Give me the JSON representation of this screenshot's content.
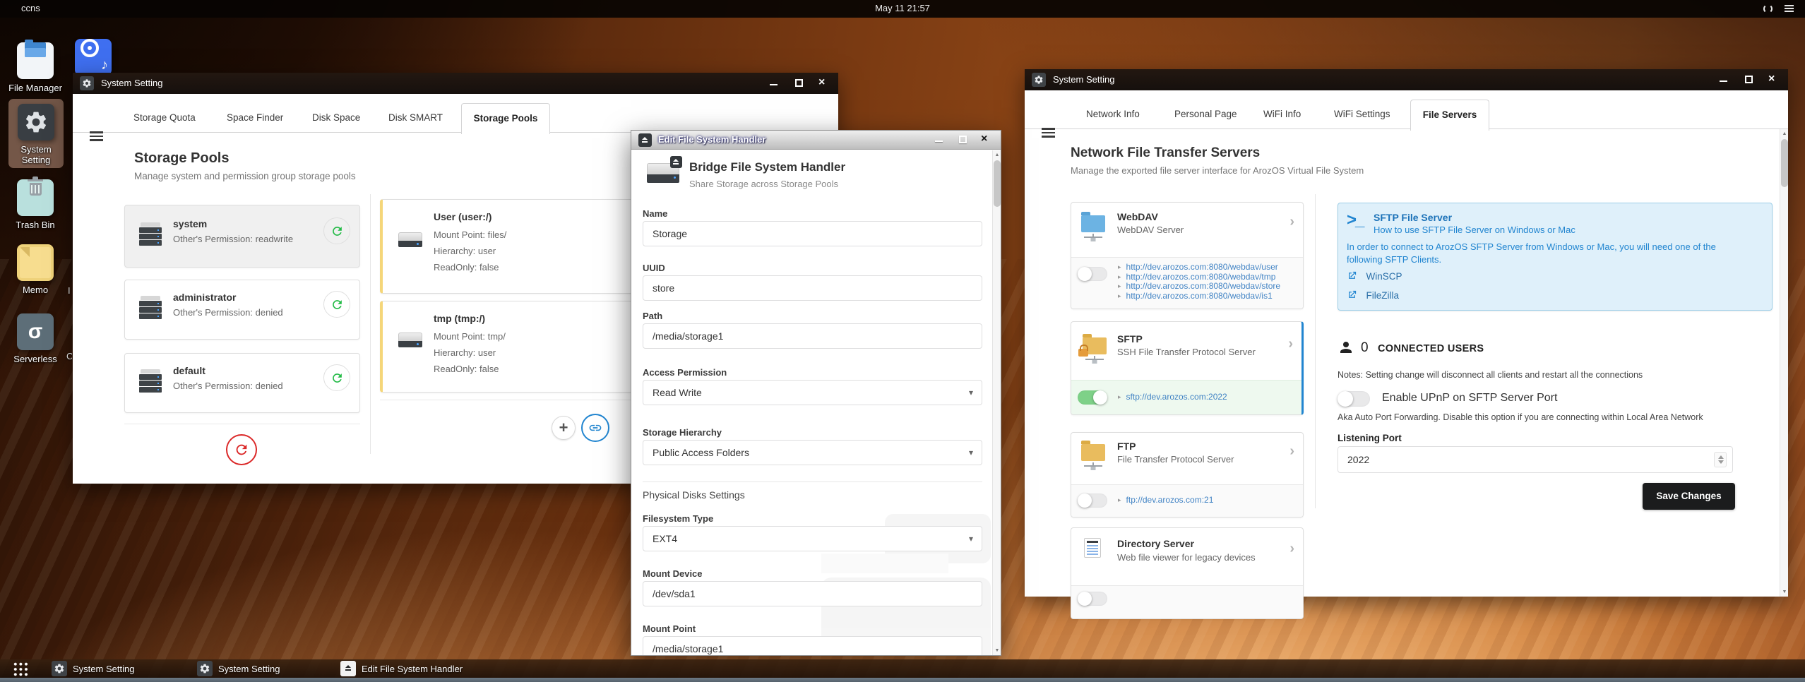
{
  "menubar": {
    "host": "ccns",
    "clock": "May 11 21:57"
  },
  "desktop": {
    "icons": [
      {
        "label": "File Manager"
      },
      {
        "label": ""
      },
      {
        "label": "System Setting"
      },
      {
        "label": "Trash Bin"
      },
      {
        "label": "Memo"
      },
      {
        "label": "Serverless"
      }
    ],
    "clipped_labels": [
      "I",
      "C"
    ]
  },
  "left_window": {
    "title": "System Setting",
    "tabs": [
      "Storage Quota",
      "Space Finder",
      "Disk Space",
      "Disk SMART",
      "Storage Pools"
    ],
    "heading": "Storage Pools",
    "subheading": "Manage system and permission group storage pools",
    "pools": [
      {
        "name": "system",
        "detail": "Other's Permission: readwrite"
      },
      {
        "name": "administrator",
        "detail": "Other's Permission: denied"
      },
      {
        "name": "default",
        "detail": "Other's Permission: denied"
      }
    ],
    "mounts": [
      {
        "name": "User (user:/)",
        "lines": [
          "Mount Point: files/",
          "Hierarchy: user",
          "ReadOnly: false"
        ]
      },
      {
        "name": "tmp (tmp:/)",
        "lines": [
          "Mount Point: tmp/",
          "Hierarchy: user",
          "ReadOnly: false"
        ]
      }
    ]
  },
  "dialog": {
    "title": "Edit File System Handler",
    "heading": "Bridge File System Handler",
    "subheading": "Share Storage across Storage Pools",
    "section_label": "Physical Disks Settings",
    "fields": {
      "name": {
        "label": "Name",
        "value": "Storage"
      },
      "uuid": {
        "label": "UUID",
        "value": "store"
      },
      "path": {
        "label": "Path",
        "value": "/media/storage1"
      },
      "access_permission": {
        "label": "Access Permission",
        "value": "Read Write"
      },
      "storage_hierarchy": {
        "label": "Storage Hierarchy",
        "value": "Public Access Folders"
      },
      "filesystem_type": {
        "label": "Filesystem Type",
        "value": "EXT4"
      },
      "mount_device": {
        "label": "Mount Device",
        "value": "/dev/sda1"
      },
      "mount_point": {
        "label": "Mount Point",
        "value": "/media/storage1"
      }
    }
  },
  "right_window": {
    "title": "System Setting",
    "tabs": [
      "Network Info",
      "Personal Page",
      "WiFi Info",
      "WiFi Settings",
      "File Servers"
    ],
    "heading": "Network File Transfer Servers",
    "subheading": "Manage the exported file server interface for ArozOS Virtual File System",
    "servers": [
      {
        "name": "WebDAV",
        "desc": "WebDAV Server",
        "enabled": false,
        "links": [
          "http://dev.arozos.com:8080/webdav/user",
          "http://dev.arozos.com:8080/webdav/tmp",
          "http://dev.arozos.com:8080/webdav/store",
          "http://dev.arozos.com:8080/webdav/is1"
        ]
      },
      {
        "name": "SFTP",
        "desc": "SSH File Transfer Protocol Server",
        "enabled": true,
        "links": [
          "sftp://dev.arozos.com:2022"
        ]
      },
      {
        "name": "FTP",
        "desc": "File Transfer Protocol Server",
        "enabled": false,
        "links": [
          "ftp://dev.arozos.com:21"
        ]
      },
      {
        "name": "Directory Server",
        "desc": "Web file viewer for legacy devices"
      }
    ],
    "sftp_help": {
      "title": "SFTP File Server",
      "subtitle": "How to use SFTP File Server on Windows or Mac",
      "body": "In order to connect to ArozOS SFTP Server from Windows or Mac, you will need one of the following SFTP Clients.",
      "clients": [
        "WinSCP",
        "FileZilla"
      ]
    },
    "sftp_settings": {
      "connected_count": "0",
      "connected_label": "CONNECTED USERS",
      "notes": "Notes: Setting change will disconnect all clients and restart all the connections",
      "upnp_label": "Enable UPnP on SFTP Server Port",
      "upnp_note": "Aka Auto Port Forwarding. Disable this option if you are connecting within Local Area Network",
      "port_label": "Listening Port",
      "port_value": "2022",
      "save_label": "Save Changes"
    }
  },
  "taskbar": {
    "items": [
      {
        "label": "System Setting"
      },
      {
        "label": "System Setting"
      },
      {
        "label": "Edit File System Handler"
      }
    ]
  },
  "colors": {
    "accent_blue": "#2185d0",
    "link_blue": "#4183c4",
    "positive_green": "#21ba45",
    "toggle_on_green": "#7ed188",
    "negative_red": "#db2828",
    "info_box_bg": "#dff0fa",
    "save_button_bg": "#1b1c1d",
    "selected_card_border": "#2185d0",
    "mount_card_accent": "#f5d679"
  }
}
